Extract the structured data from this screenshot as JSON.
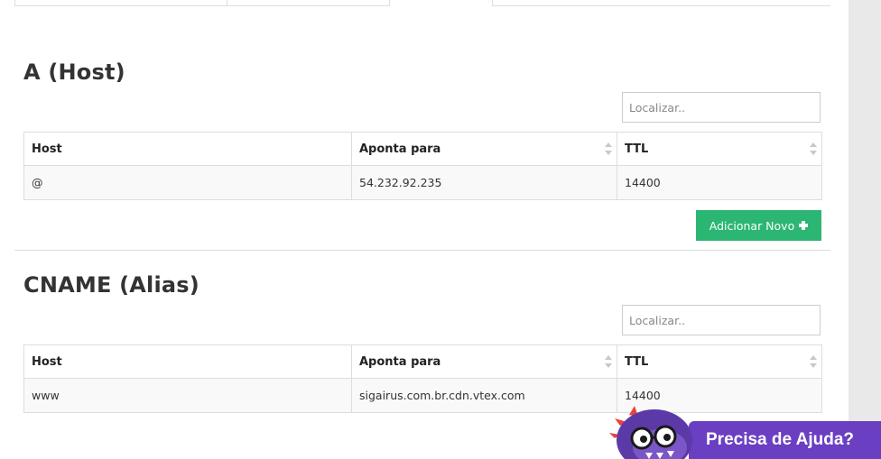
{
  "sections": [
    {
      "title": "A (Host)",
      "search_placeholder": "Localizar..",
      "columns": [
        "Host",
        "Aponta para",
        "TTL"
      ],
      "rows": [
        {
          "host": "@",
          "points_to": "54.232.92.235",
          "ttl": "14400"
        }
      ],
      "add_button_label": "Adicionar Novo"
    },
    {
      "title": "CNAME (Alias)",
      "search_placeholder": "Localizar..",
      "columns": [
        "Host",
        "Aponta para",
        "TTL"
      ],
      "rows": [
        {
          "host": "www",
          "points_to": "sigairus.com.br.cdn.vtex.com",
          "ttl": "14400"
        }
      ]
    }
  ],
  "help_widget": {
    "label": "Precisa de Ajuda?",
    "bar_color": "#6a3fc2"
  },
  "colors": {
    "accent_green": "#2bb673",
    "border": "#dddddd"
  },
  "icons": {
    "sort": "sort-icon",
    "plus": "plus-icon",
    "mascot": "dinosaur-mascot-icon"
  }
}
